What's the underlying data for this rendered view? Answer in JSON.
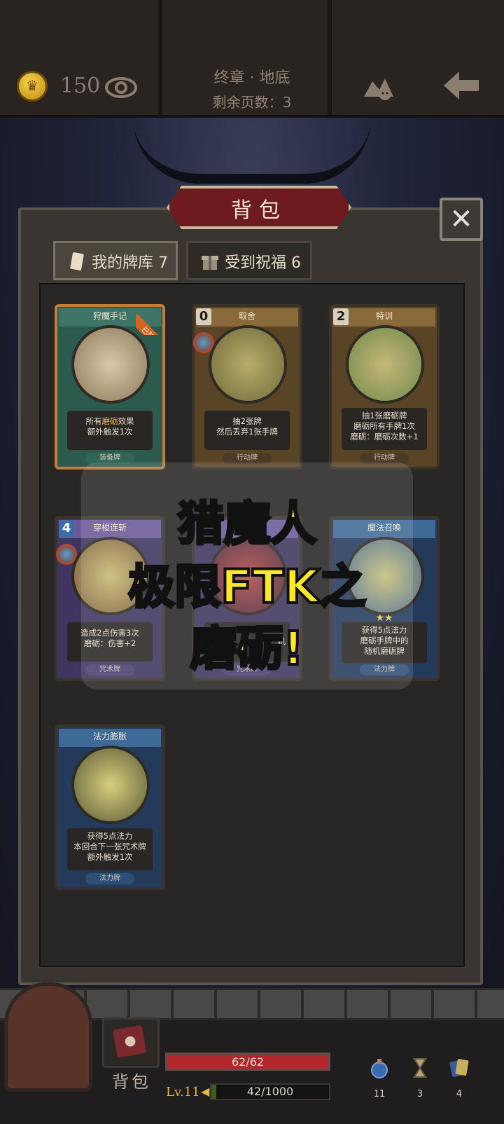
{
  "header": {
    "coins": "150",
    "chapter": "终章 · 地底",
    "pages_remaining": "剩余页数：3"
  },
  "panel": {
    "title": "背包",
    "tabs": [
      {
        "label": "我的牌库 7"
      },
      {
        "label": "受到祝福 6"
      }
    ]
  },
  "cards": [
    {
      "name": "狩魔手记",
      "badge": "已装备",
      "desc1": "所有",
      "desc1_hl": "磨砺",
      "desc1_tail": "效果",
      "desc2": "额外触发1次",
      "desc3": "",
      "type": "装备牌"
    },
    {
      "name": "取舍",
      "cost": "0",
      "desc1": "抽2张牌",
      "desc2": "然后丢弃1张手牌",
      "desc3": "",
      "type": "行动牌"
    },
    {
      "name": "特训",
      "cost": "2",
      "desc1": "抽1张磨砺牌",
      "desc2": "磨砺所有手牌1次",
      "desc3": "磨砺：磨砺次数+1",
      "type": "行动牌"
    },
    {
      "name": "穿梭连斩",
      "cost": "4",
      "desc1": "造成2点伤害3次",
      "desc2": "磨砺：伤害+2",
      "desc3": "",
      "type": "咒术牌"
    },
    {
      "name": "",
      "cost": "",
      "desc1": "",
      "desc2": "机",
      "desc3": "",
      "type": "咒术牌"
    },
    {
      "name": "魔法召唤",
      "cost": "",
      "stars": "★★",
      "desc1": "获得5点法力",
      "desc2": "磨砺手牌中的",
      "desc3": "随机磨砺牌",
      "type": "法力牌"
    },
    {
      "name": "法力膨胀",
      "cost": "",
      "desc1": "获得5点法力",
      "desc2": "本回合下一张咒术牌",
      "desc3": "额外触发1次",
      "type": "法力牌"
    }
  ],
  "overlay": {
    "line1": "猎魔人",
    "line2": "极限FTK之",
    "line3": "磨砺!"
  },
  "bottom": {
    "bag_label": "背包",
    "hp": "62/62",
    "hp_fraction": 1.0,
    "level": "Lv.11",
    "xp": "42/1000",
    "xp_fraction": 0.042,
    "stats": [
      {
        "icon": "potion-icon",
        "value": "11"
      },
      {
        "icon": "hourglass-icon",
        "value": "3"
      },
      {
        "icon": "cards-icon",
        "value": "4"
      }
    ]
  },
  "colors": {
    "accent_red": "#6e1b1f",
    "gold": "#e1b642",
    "overlay_text": "#ffe82a"
  }
}
